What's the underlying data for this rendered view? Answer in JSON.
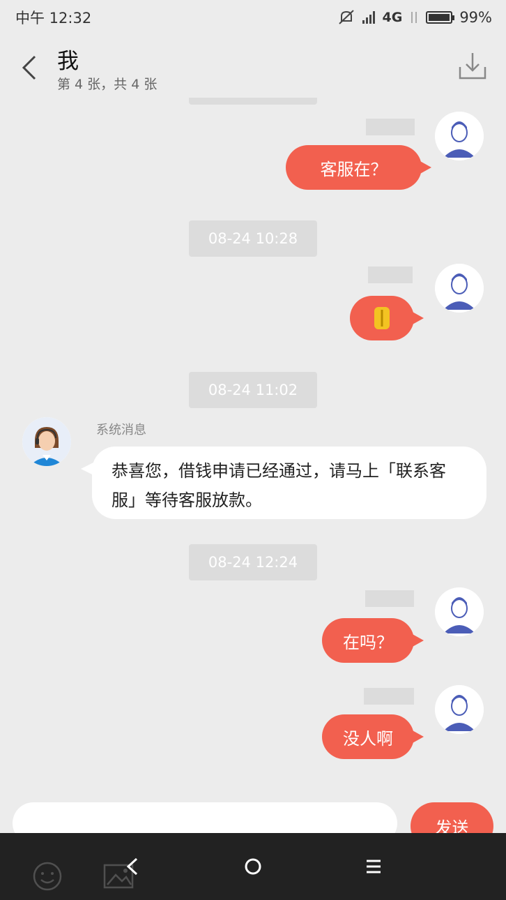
{
  "status_bar": {
    "time": "中午 12:32",
    "network": "4G",
    "battery": "99%"
  },
  "header": {
    "title": "我",
    "subtitle": "第 4 张，共 4 张"
  },
  "chat": {
    "times": [
      "08-24 10:28",
      "08-24 11:02",
      "08-24 12:24"
    ],
    "messages": [
      {
        "from": "me",
        "text": "客服在？"
      },
      {
        "from": "me",
        "text": "图片"
      },
      {
        "from": "system",
        "sender": "系统消息",
        "text": "恭喜您，借钱申请已经通过，请马上「联系客服」等待客服放款。"
      },
      {
        "from": "me",
        "text": "在吗？"
      },
      {
        "from": "me",
        "text": "没人啊"
      }
    ]
  },
  "input": {
    "placeholder": "",
    "send_label": "发送"
  },
  "icons": {
    "back": "chevron-left-icon",
    "download": "download-icon",
    "emoji": "emoji-icon",
    "image": "image-icon"
  },
  "colors": {
    "accent": "#f2604f",
    "background": "#ececec"
  }
}
